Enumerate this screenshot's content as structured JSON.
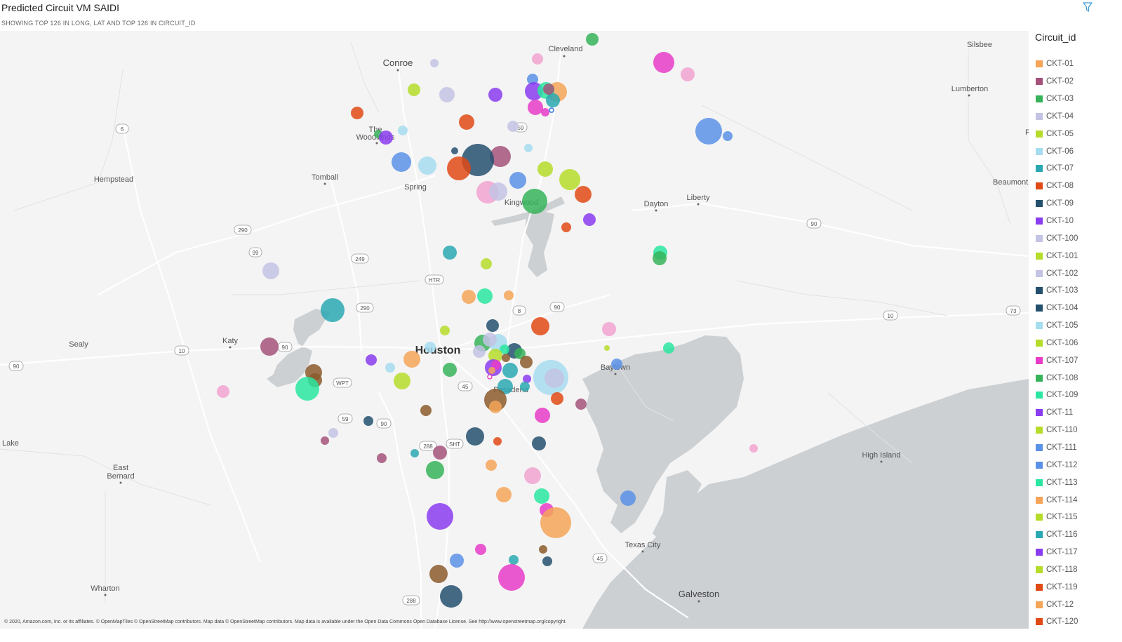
{
  "header": {
    "title": "Predicted Circuit VM SAIDI",
    "subtitle": "SHOWING TOP 126 IN LONG, LAT AND TOP 126 IN CIRCUIT_ID",
    "filter_icon": "filter-icon"
  },
  "map": {
    "places": [
      {
        "name": "Conroe",
        "major": true
      },
      {
        "name": "Cleveland",
        "major": false
      },
      {
        "name": "Silsbee",
        "major": false
      },
      {
        "name": "Lumberton",
        "major": false
      },
      {
        "name": "The",
        "major": false
      },
      {
        "name": "Woodlands",
        "major": false
      },
      {
        "name": "Hempstead",
        "major": false
      },
      {
        "name": "Tomball",
        "major": false
      },
      {
        "name": "Spring",
        "major": false
      },
      {
        "name": "Kingwood",
        "major": false
      },
      {
        "name": "Dayton",
        "major": false
      },
      {
        "name": "Liberty",
        "major": false
      },
      {
        "name": "Beaumont",
        "major": false
      },
      {
        "name": "Sealy",
        "major": false
      },
      {
        "name": "Katy",
        "major": false
      },
      {
        "name": "Houston",
        "major": true
      },
      {
        "name": "Baytown",
        "major": false
      },
      {
        "name": "Pasadena",
        "major": false
      },
      {
        "name": "Lake",
        "major": false
      },
      {
        "name": "East",
        "major": false
      },
      {
        "name": "Bernard",
        "major": false
      },
      {
        "name": "High Island",
        "major": false
      },
      {
        "name": "Texas City",
        "major": false
      },
      {
        "name": "Wharton",
        "major": false
      },
      {
        "name": "Galveston",
        "major": true
      },
      {
        "name": "F",
        "major": false
      }
    ],
    "shields": [
      "6",
      "290",
      "99",
      "249",
      "290",
      "HTR",
      "8",
      "90",
      "90",
      "90",
      "10",
      "73",
      "90",
      "10",
      "WPT",
      "45",
      "59",
      "90",
      "288",
      "SHT",
      "45",
      "288",
      "59"
    ],
    "attribution": "© 2020, Amazon.com, Inc. or its affiliates. © OpenMapTiles © OpenStreetMap contributors. Map data © OpenStreetMap contributors. Map data is available under the Open Data Commons Open Database License. See http://www.openstreetmap.org/copyright."
  },
  "legend": {
    "title": "Circuit_id",
    "items": [
      {
        "label": "CKT-01",
        "color": "#f5a458"
      },
      {
        "label": "CKT-02",
        "color": "#a4527a"
      },
      {
        "label": "CKT-03",
        "color": "#36b35a"
      },
      {
        "label": "CKT-04",
        "color": "#c3c3e4"
      },
      {
        "label": "CKT-05",
        "color": "#b6dc2a"
      },
      {
        "label": "CKT-06",
        "color": "#a6dcef"
      },
      {
        "label": "CKT-07",
        "color": "#2aa8b2"
      },
      {
        "label": "CKT-08",
        "color": "#e04a16"
      },
      {
        "label": "CKT-09",
        "color": "#24506e"
      },
      {
        "label": "CKT-10",
        "color": "#8a3cf0"
      },
      {
        "label": "CKT-100",
        "color": "#c3c3e4"
      },
      {
        "label": "CKT-101",
        "color": "#b6dc2a"
      },
      {
        "label": "CKT-102",
        "color": "#c3c3e4"
      },
      {
        "label": "CKT-103",
        "color": "#24506e"
      },
      {
        "label": "CKT-104",
        "color": "#24506e"
      },
      {
        "label": "CKT-105",
        "color": "#a6dcef"
      },
      {
        "label": "CKT-106",
        "color": "#b6dc2a"
      },
      {
        "label": "CKT-107",
        "color": "#e83cc8"
      },
      {
        "label": "CKT-108",
        "color": "#36b35a"
      },
      {
        "label": "CKT-109",
        "color": "#2ae6a0"
      },
      {
        "label": "CKT-11",
        "color": "#8a3cf0"
      },
      {
        "label": "CKT-110",
        "color": "#b6dc2a"
      },
      {
        "label": "CKT-111",
        "color": "#5a90e6"
      },
      {
        "label": "CKT-112",
        "color": "#5a90e6"
      },
      {
        "label": "CKT-113",
        "color": "#2ae6a0"
      },
      {
        "label": "CKT-114",
        "color": "#f5a458"
      },
      {
        "label": "CKT-115",
        "color": "#b6dc2a"
      },
      {
        "label": "CKT-116",
        "color": "#2aa8b2"
      },
      {
        "label": "CKT-117",
        "color": "#8a3cf0"
      },
      {
        "label": "CKT-118",
        "color": "#b6dc2a"
      },
      {
        "label": "CKT-119",
        "color": "#e04a16"
      },
      {
        "label": "CKT-12",
        "color": "#f5a458"
      },
      {
        "label": "CKT-120",
        "color": "#e04a16"
      }
    ]
  }
}
